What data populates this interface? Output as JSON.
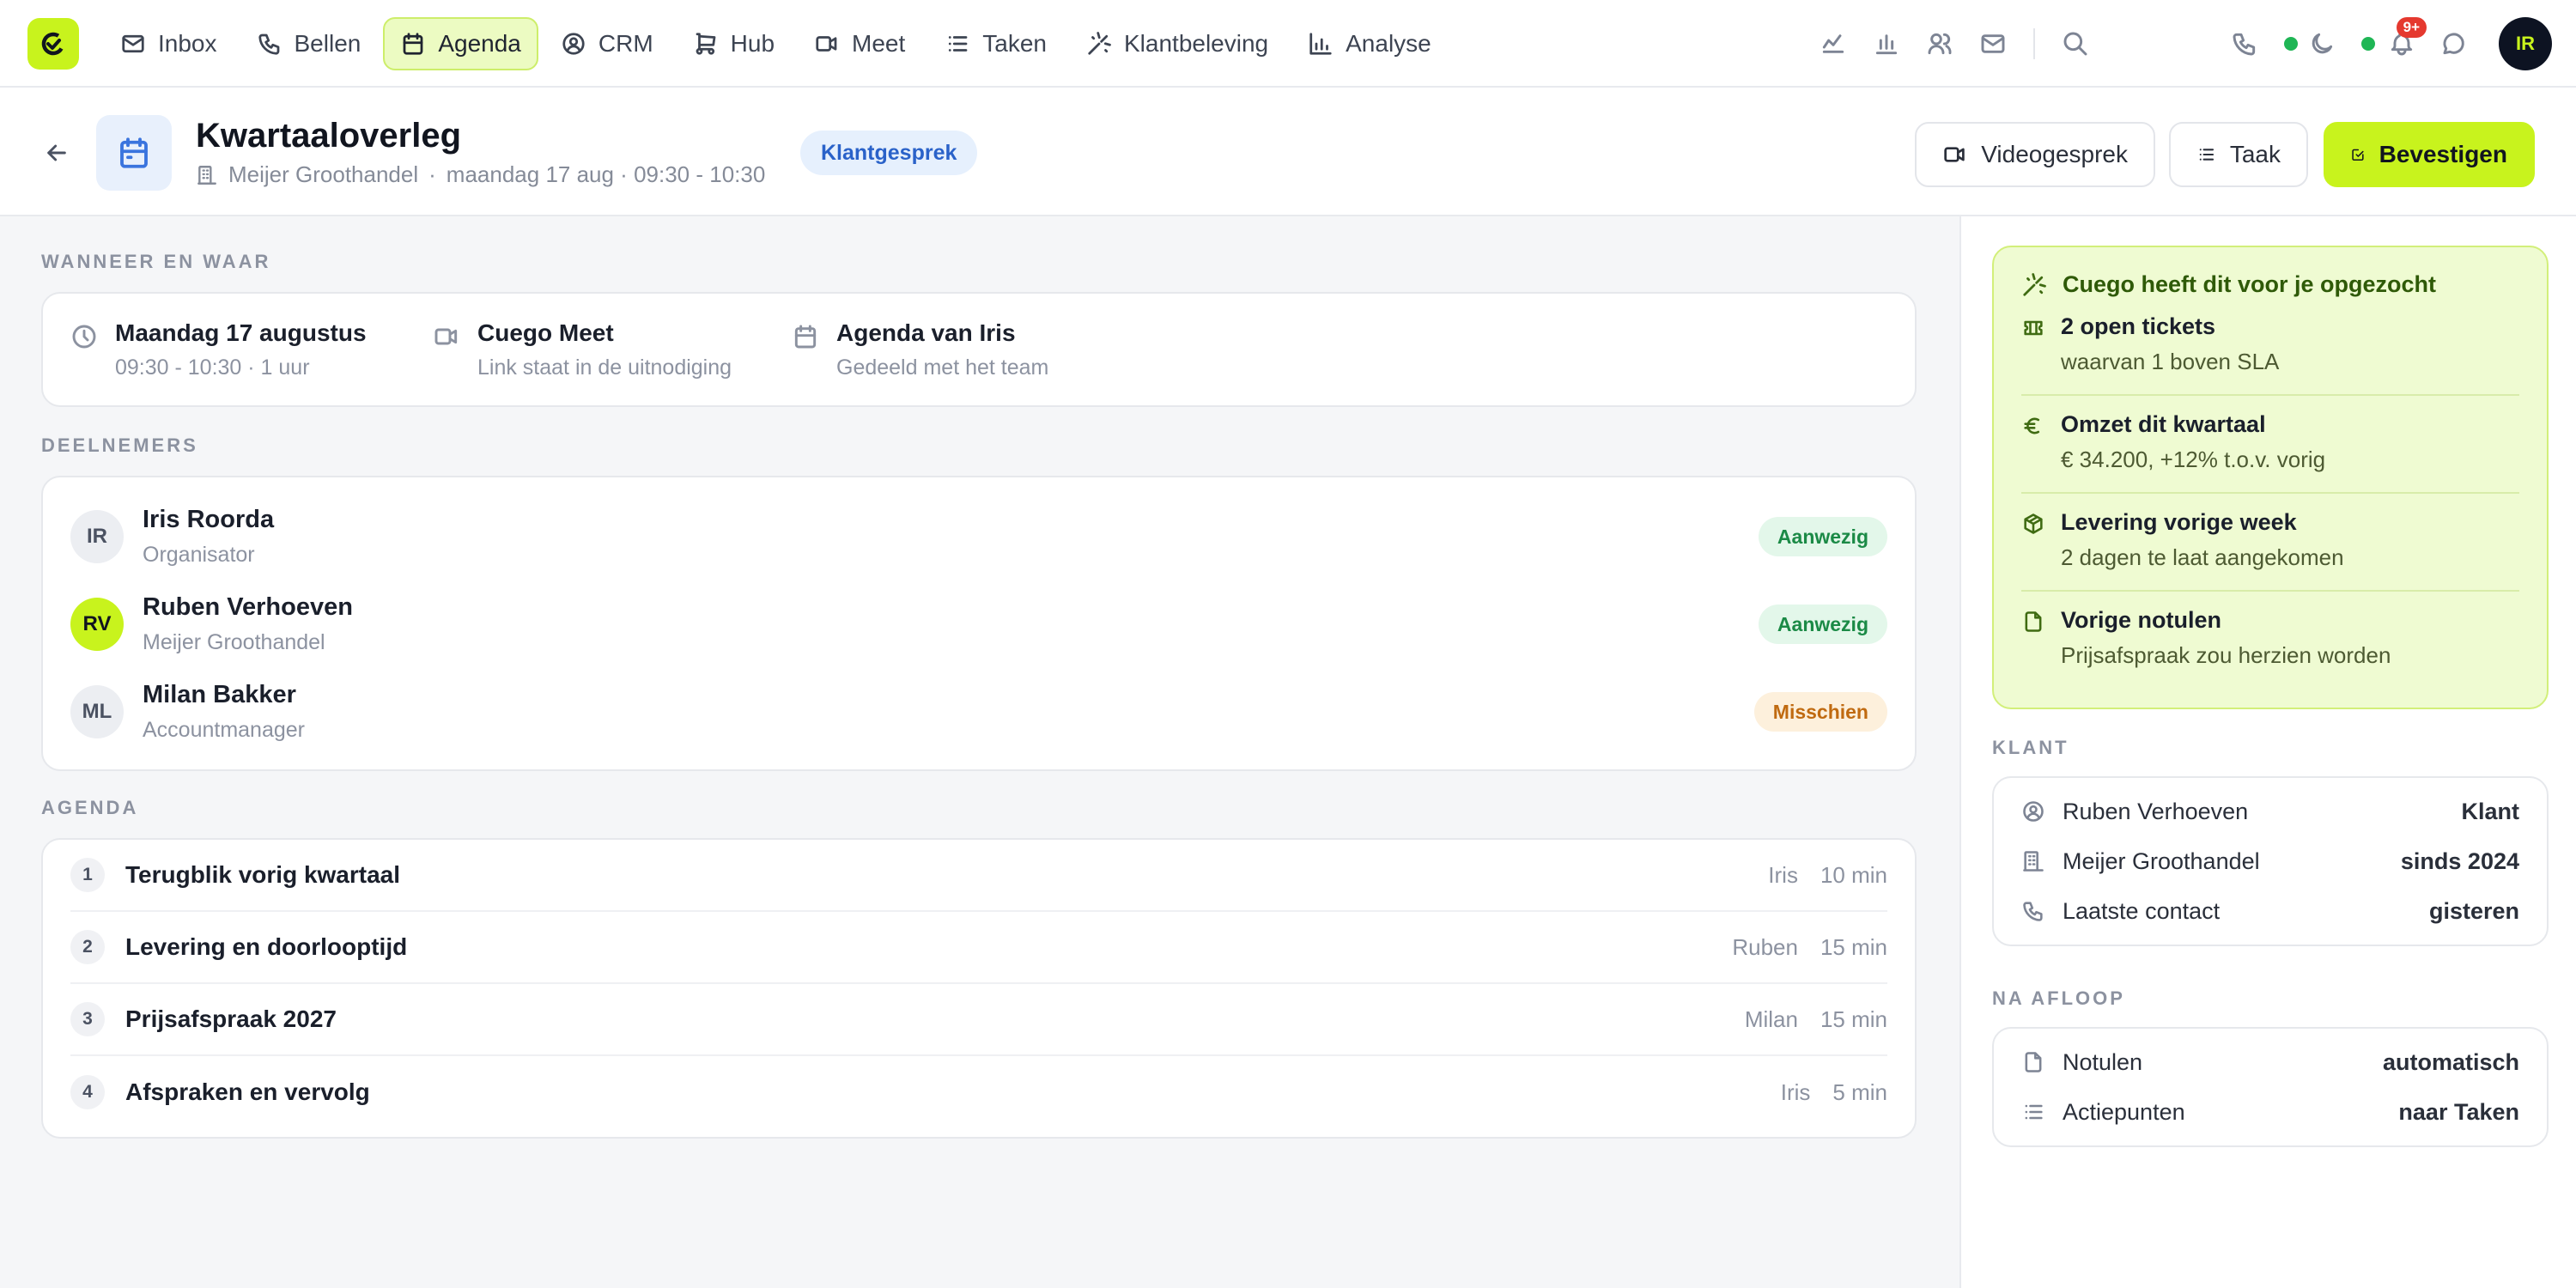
{
  "nav": {
    "items": [
      {
        "label": "Inbox",
        "icon": "mail-icon"
      },
      {
        "label": "Bellen",
        "icon": "phone-icon"
      },
      {
        "label": "Agenda",
        "icon": "calendar-icon",
        "active": true
      },
      {
        "label": "CRM",
        "icon": "user-circle-icon"
      },
      {
        "label": "Hub",
        "icon": "cart-icon"
      },
      {
        "label": "Meet",
        "icon": "video-icon"
      },
      {
        "label": "Taken",
        "icon": "list-icon"
      },
      {
        "label": "Klantbeleving",
        "icon": "sparkle-icon"
      },
      {
        "label": "Analyse",
        "icon": "bar-chart-icon"
      }
    ],
    "notification_count": "9+",
    "user_initials": "IR"
  },
  "header": {
    "title": "Kwartaaloverleg",
    "company": "Meijer Groothandel",
    "separator": "·",
    "datetime": "maandag 17 aug · 09:30 - 10:30",
    "badge": "Klantgesprek",
    "buttons": {
      "video": "Videogesprek",
      "task": "Taak",
      "confirm": "Bevestigen"
    }
  },
  "when": {
    "label": "WANNEER EN WAAR",
    "items": [
      {
        "title": "Maandag 17 augustus",
        "sub": "09:30 - 10:30 · 1 uur"
      },
      {
        "title": "Cuego Meet",
        "sub": "Link staat in de uitnodiging"
      },
      {
        "title": "Agenda van Iris",
        "sub": "Gedeeld met het team"
      }
    ]
  },
  "participants": {
    "label": "DEELNEMERS",
    "items": [
      {
        "initials": "IR",
        "name": "Iris Roorda",
        "role": "Organisator",
        "status": "Aanwezig"
      },
      {
        "initials": "RV",
        "name": "Ruben Verhoeven",
        "role": "Meijer Groothandel",
        "status": "Aanwezig"
      },
      {
        "initials": "ML",
        "name": "Milan Bakker",
        "role": "Accountmanager",
        "status": "Misschien"
      }
    ]
  },
  "agenda": {
    "label": "AGENDA",
    "items": [
      {
        "num": "1",
        "title": "Terugblik vorig kwartaal",
        "who": "Iris",
        "duration": "10 min"
      },
      {
        "num": "2",
        "title": "Levering en doorlooptijd",
        "who": "Ruben",
        "duration": "15 min"
      },
      {
        "num": "3",
        "title": "Prijsafspraak 2027",
        "who": "Milan",
        "duration": "15 min"
      },
      {
        "num": "4",
        "title": "Afspraken en vervolg",
        "who": "Iris",
        "duration": "5 min"
      }
    ]
  },
  "insights": {
    "title": "Cuego heeft dit voor je opgezocht",
    "items": [
      {
        "title": "2 open tickets",
        "desc": "waarvan 1 boven SLA"
      },
      {
        "title": "Omzet dit kwartaal",
        "desc": "€ 34.200, +12% t.o.v. vorig"
      },
      {
        "title": "Levering vorige week",
        "desc": "2 dagen te laat aangekomen"
      },
      {
        "title": "Vorige notulen",
        "desc": "Prijsafspraak zou herzien worden"
      }
    ]
  },
  "client": {
    "label": "KLANT",
    "rows": [
      {
        "key": "Ruben Verhoeven",
        "value": "Klant"
      },
      {
        "key": "Meijer Groothandel",
        "value": "sinds 2024"
      },
      {
        "key": "Laatste contact",
        "value": "gisteren"
      }
    ]
  },
  "after": {
    "label": "NA AFLOOP",
    "rows": [
      {
        "key": "Notulen",
        "value": "automatisch"
      },
      {
        "key": "Actiepunten",
        "value": "naar Taken"
      }
    ]
  },
  "colors": {
    "accent": "#c8f31d",
    "status_yes": "#1b8a46",
    "status_maybe": "#c06a10",
    "notification": "#e5392f"
  }
}
